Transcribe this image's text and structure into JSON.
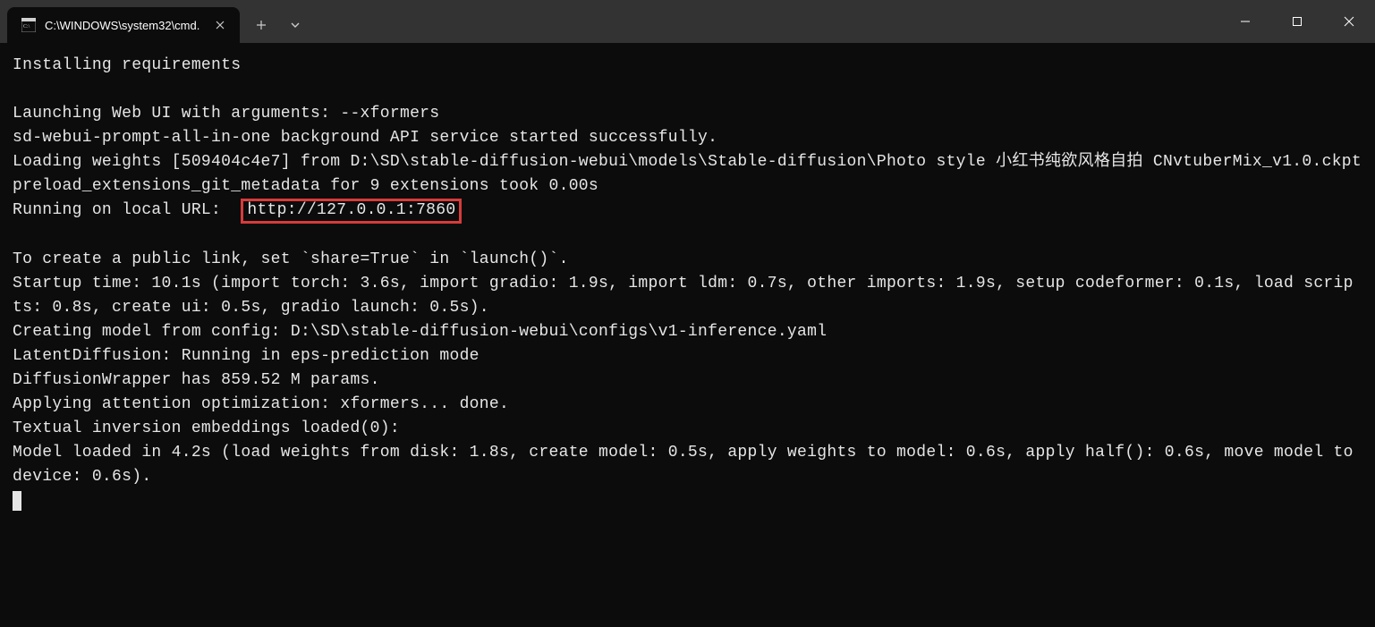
{
  "titlebar": {
    "tab_title": "C:\\WINDOWS\\system32\\cmd."
  },
  "terminal": {
    "lines_before": [
      "Installing requirements",
      "",
      "Launching Web UI with arguments: --xformers",
      "sd-webui-prompt-all-in-one background API service started successfully.",
      "Loading weights [509404c4e7] from D:\\SD\\stable-diffusion-webui\\models\\Stable-diffusion\\Photo style 小红书纯欲风格自拍 CNvtuberMix_v1.0.ckpt",
      "preload_extensions_git_metadata for 9 extensions took 0.00s"
    ],
    "url_line_prefix": "Running on local URL:  ",
    "url_highlight": "http://127.0.0.1:7860",
    "lines_after": [
      "",
      "To create a public link, set `share=True` in `launch()`.",
      "Startup time: 10.1s (import torch: 3.6s, import gradio: 1.9s, import ldm: 0.7s, other imports: 1.9s, setup codeformer: 0.1s, load scripts: 0.8s, create ui: 0.5s, gradio launch: 0.5s).",
      "Creating model from config: D:\\SD\\stable-diffusion-webui\\configs\\v1-inference.yaml",
      "LatentDiffusion: Running in eps-prediction mode",
      "DiffusionWrapper has 859.52 M params.",
      "Applying attention optimization: xformers... done.",
      "Textual inversion embeddings loaded(0):",
      "Model loaded in 4.2s (load weights from disk: 1.8s, create model: 0.5s, apply weights to model: 0.6s, apply half(): 0.6s, move model to device: 0.6s)."
    ]
  }
}
